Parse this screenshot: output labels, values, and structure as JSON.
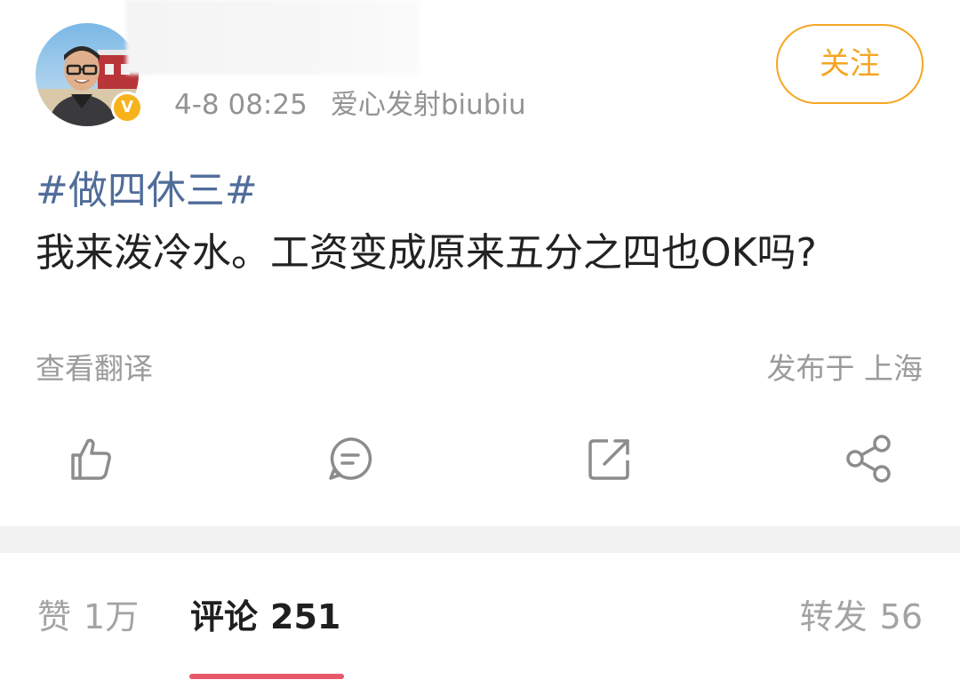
{
  "post": {
    "timestamp": "4-8 08:25",
    "source": "爱心发射biubiu",
    "follow_label": "关注",
    "verified_label": "V",
    "hashtag": "#做四休三#",
    "text": "我来泼冷水。工资变成原来五分之四也OK吗?",
    "translate_label": "查看翻译",
    "location": "发布于 上海"
  },
  "actions": {
    "like_icon": "thumbs-up-icon",
    "comment_icon": "comment-bubble-icon",
    "repost_icon": "repost-square-icon",
    "share_icon": "share-nodes-icon"
  },
  "tabs": {
    "likes": {
      "label": "赞",
      "count": "1万"
    },
    "comments": {
      "label": "评论",
      "count": "251"
    },
    "reposts": {
      "label": "转发",
      "count": "56"
    }
  },
  "colors": {
    "accent_orange": "#f5a623",
    "hashtag_blue": "#506d9a",
    "tab_underline": "#e8596a",
    "badge_gold": "#f7b31c",
    "icon_gray": "#8c8c8c"
  }
}
